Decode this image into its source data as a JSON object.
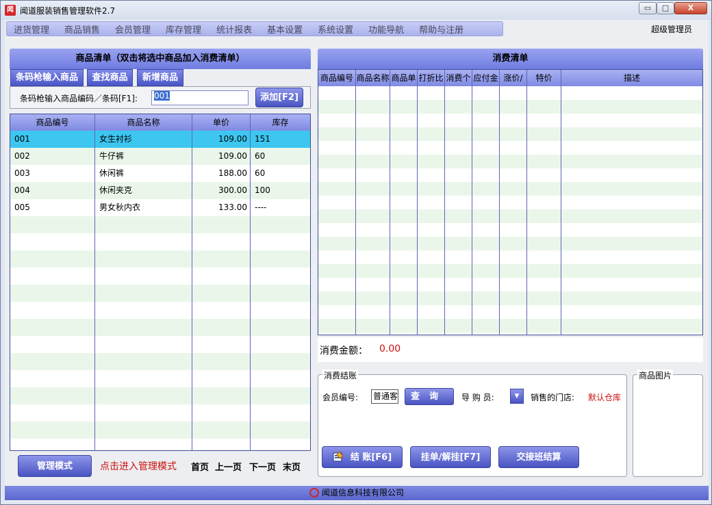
{
  "window": {
    "app_icon_text": "闻",
    "title": "闻道服装销售管理软件2.7",
    "min_label": "▭",
    "max_label": "□",
    "close_label": "X"
  },
  "menu": {
    "items": [
      "进货管理",
      "商品销售",
      "会员管理",
      "库存管理",
      "统计报表",
      "基本设置",
      "系统设置",
      "功能导航",
      "帮助与注册"
    ],
    "role": "超级管理员"
  },
  "goods_panel": {
    "title": "商品清单（双击将选中商品加入消费清单）",
    "tabs": [
      "条码枪输入商品",
      "查找商品",
      "新增商品"
    ],
    "barcode_label": "条码枪输入商品编码／条码[F1]:",
    "barcode_value": "001",
    "add_button": "添加[F2]",
    "columns": [
      "商品编号",
      "商品名称",
      "单价",
      "库存"
    ],
    "rows": [
      [
        "001",
        "女生衬衫",
        "109.00",
        "151"
      ],
      [
        "002",
        "牛仔裤",
        "109.00",
        "60"
      ],
      [
        "003",
        "休闲裤",
        "188.00",
        "60"
      ],
      [
        "004",
        "休闲夹克",
        "300.00",
        "100"
      ],
      [
        "005",
        "男女秋内衣",
        "133.00",
        "----"
      ]
    ],
    "selected_row": 0
  },
  "bottom_left": {
    "mgmt_button": "管理模式",
    "mgmt_hint": "点击进入管理模式",
    "pager": [
      "首页",
      "上一页",
      "下一页",
      "末页"
    ]
  },
  "consume_panel": {
    "title": "消费清单",
    "columns": [
      "商品编号",
      "商品名称",
      "商品单",
      "打折比",
      "消费个",
      "应付金",
      "涨价/",
      "特价",
      "描述"
    ],
    "amount_label": "消费金额：",
    "amount_value": "0.00"
  },
  "checkout": {
    "group_title": "消费结账",
    "member_label": "会员编号:",
    "member_value": "普通客",
    "query_button": "查询",
    "guide_label": "导 购 员:",
    "guide_arrow": "▼",
    "store_label": "销售的门店:",
    "store_value": "默认仓库",
    "checkout_button": "结  账[F6]",
    "hang_button": "挂单/解挂[F7]",
    "shift_button": "交接班结算"
  },
  "image_box": {
    "title": "商品图片"
  },
  "footer": {
    "company": "闻道信息科技有限公司"
  }
}
